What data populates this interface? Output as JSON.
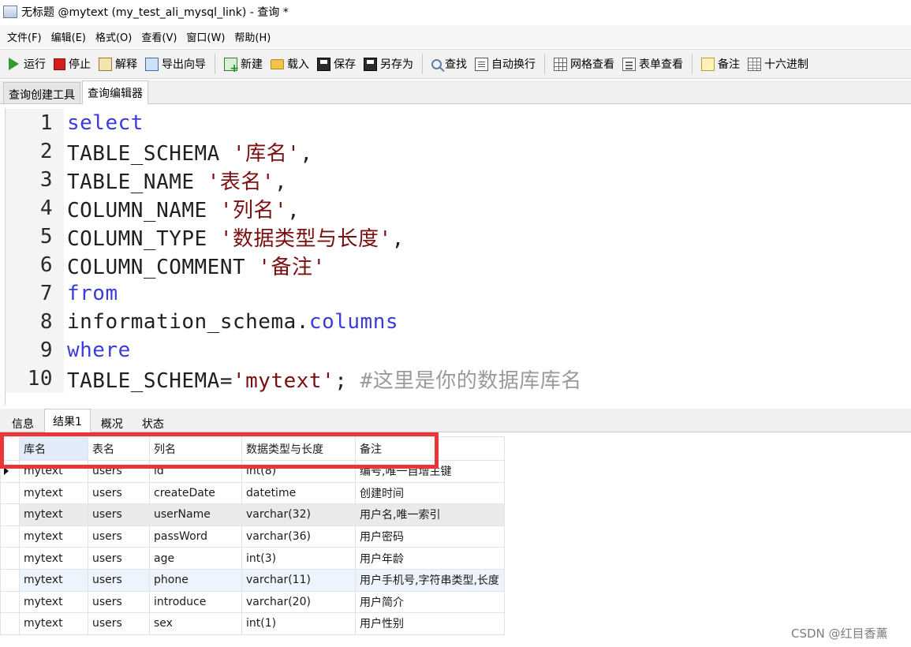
{
  "window": {
    "title": "无标题 @mytext (my_test_ali_mysql_link) - 查询 *"
  },
  "menu": [
    "文件(F)",
    "编辑(E)",
    "格式(O)",
    "查看(V)",
    "窗口(W)",
    "帮助(H)"
  ],
  "toolbar": [
    {
      "label": "运行",
      "icon": "run-icon"
    },
    {
      "label": "停止",
      "icon": "stop-icon"
    },
    {
      "label": "解释",
      "icon": "explain-icon"
    },
    {
      "label": "导出向导",
      "icon": "export-wizard-icon"
    },
    {
      "label": "新建",
      "icon": "new-query-icon"
    },
    {
      "label": "载入",
      "icon": "folder-icon"
    },
    {
      "label": "保存",
      "icon": "save-icon"
    },
    {
      "label": "另存为",
      "icon": "save-as-icon"
    },
    {
      "label": "查找",
      "icon": "search-icon"
    },
    {
      "label": "自动换行",
      "icon": "word-wrap-icon"
    },
    {
      "label": "网格查看",
      "icon": "grid-view-icon"
    },
    {
      "label": "表单查看",
      "icon": "form-view-icon"
    },
    {
      "label": "备注",
      "icon": "note-icon"
    },
    {
      "label": "十六进制",
      "icon": "hex-view-icon"
    }
  ],
  "editor_tabs": [
    {
      "label": "查询创建工具",
      "active": false
    },
    {
      "label": "查询编辑器",
      "active": true
    }
  ],
  "sql": {
    "line_numbers": [
      "1",
      "2",
      "3",
      "4",
      "5",
      "6",
      "7",
      "8",
      "9",
      "10"
    ],
    "line1": {
      "kw": "select"
    },
    "line2": {
      "ident": "TABLE_SCHEMA ",
      "str": "'库名'",
      "tail": ","
    },
    "line3": {
      "ident": "TABLE_NAME ",
      "str": "'表名'",
      "tail": ","
    },
    "line4": {
      "ident": "COLUMN_NAME ",
      "str": "'列名'",
      "tail": ","
    },
    "line5": {
      "ident": "COLUMN_TYPE ",
      "str": "'数据类型与长度'",
      "tail": ","
    },
    "line6": {
      "ident": "COLUMN_COMMENT ",
      "str": "'备注'"
    },
    "line7": {
      "kw": "from"
    },
    "line8": {
      "ident": "information_schema.",
      "kw": "columns"
    },
    "line9": {
      "kw": "where"
    },
    "line10": {
      "ident": "TABLE_SCHEMA=",
      "str": "'mytext'",
      "tail": "; ",
      "comment": "#这里是你的数据库库名"
    }
  },
  "result_tabs": [
    "信息",
    "结果1",
    "概况",
    "状态"
  ],
  "result_active_tab": "结果1",
  "grid": {
    "headers": [
      "库名",
      "表名",
      "列名",
      "数据类型与长度",
      "备注"
    ],
    "rows": [
      [
        "mytext",
        "users",
        "id",
        "int(8)",
        "编号,唯一自增主键"
      ],
      [
        "mytext",
        "users",
        "createDate",
        "datetime",
        "创建时间"
      ],
      [
        "mytext",
        "users",
        "userName",
        "varchar(32)",
        "用户名,唯一索引"
      ],
      [
        "mytext",
        "users",
        "passWord",
        "varchar(36)",
        "用户密码"
      ],
      [
        "mytext",
        "users",
        "age",
        "int(3)",
        "用户年龄"
      ],
      [
        "mytext",
        "users",
        "phone",
        "varchar(11)",
        "用户手机号,字符串类型,长度"
      ],
      [
        "mytext",
        "users",
        "introduce",
        "varchar(20)",
        "用户简介"
      ],
      [
        "mytext",
        "users",
        "sex",
        "int(1)",
        "用户性别"
      ]
    ]
  },
  "watermark": "CSDN @红目香薰",
  "colors": {
    "keyword": "#3a3cd8",
    "string": "#7a0f0f",
    "annotation_box": "#e8363b"
  }
}
